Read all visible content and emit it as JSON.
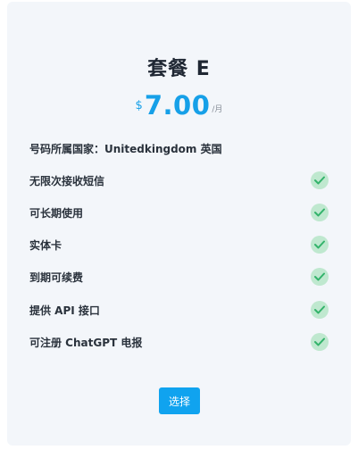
{
  "plan": {
    "title": "套餐 E",
    "currency_symbol": "$",
    "price": "7.00",
    "period": "/月",
    "country_line": "号码所属国家：Unitedkingdom 英国",
    "features": [
      {
        "label": "无限次接收短信",
        "icon": "check-icon"
      },
      {
        "label": "可长期使用",
        "icon": "check-icon"
      },
      {
        "label": "实体卡",
        "icon": "check-icon"
      },
      {
        "label": "到期可续费",
        "icon": "check-icon"
      },
      {
        "label": "提供 API 接口",
        "icon": "check-icon"
      },
      {
        "label": "可注册 ChatGPT 电报",
        "icon": "check-icon"
      }
    ],
    "select_label": "选择"
  },
  "colors": {
    "accent": "#10a3ef",
    "check_bg": "#bfe8cf",
    "check_mark": "#33b36b",
    "card_bg": "#f3f6fa"
  }
}
